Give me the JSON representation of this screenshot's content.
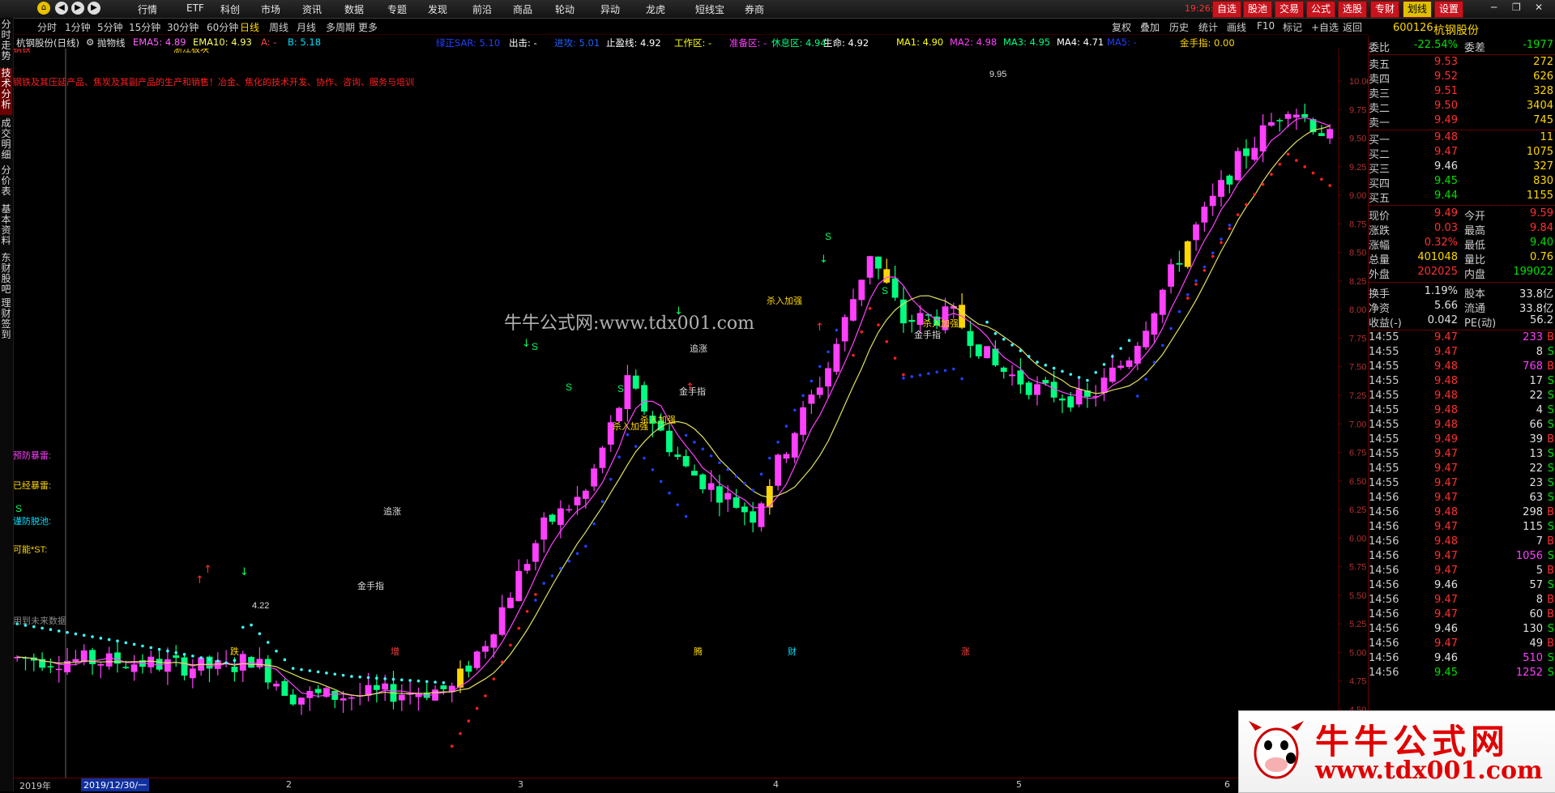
{
  "topbar": {
    "menus": [
      "行情",
      "ETF",
      "科创",
      "市场",
      "资讯",
      "数据",
      "专题",
      "发现",
      "前沿",
      "商品",
      "轮动",
      "异动",
      "龙虎",
      "短线宝",
      "券商"
    ],
    "clock": "19:26:03",
    "weekday": "周一",
    "right_buttons": [
      "自选",
      "股池",
      "交易",
      "公式",
      "选股",
      "专财",
      "划线",
      "设置"
    ]
  },
  "periodbar": {
    "periods": [
      "分时",
      "1分钟",
      "5分钟",
      "15分钟",
      "30分钟",
      "60分钟",
      "日线",
      "周线",
      "月线",
      "多周期",
      "更多"
    ],
    "active": "日线",
    "tools": [
      "复权",
      "叠加",
      "历史",
      "统计",
      "画线",
      "F10",
      "标记",
      "+自选",
      "返回"
    ]
  },
  "lefttabs": [
    "分时走势",
    "技术分析",
    "成交明细",
    "分价表",
    "基本资料",
    "东财股吧",
    "理财签到"
  ],
  "lefttabs_active": "技术分析",
  "indicator_line": {
    "name": "杭钢股份(日线)",
    "type": "抛物线",
    "ema5": "EMA5: 4.89",
    "ema10": "EMA10: 4.93",
    "a": "A: -",
    "b": "B: 5.18",
    "sar": "绿正SAR: 5.10",
    "out": "出击: -",
    "buy": "进攻: 5.01",
    "stop": "止盈线: 4.92",
    "work": "工作区: -",
    "ready": "准备区: -",
    "rest": "休息区: 4.94",
    "life": "生命: 4.92",
    "ma1": "MA1: 4.90",
    "ma2": "MA2: 4.98",
    "ma3": "MA3: 4.95",
    "ma4": "MA4: 4.71",
    "ma5": "MA5: -",
    "golden": "金手指: 0.00"
  },
  "chart_text": {
    "sector": "钢铁",
    "board": "浙江板块",
    "desc": "钢铁及其压延产品、焦炭及其副产品的生产和销售！冶金、焦化的技术开发、协作、咨询、服务与培训",
    "warn1": "预防暴雷:",
    "warn2": "已经暴雷:",
    "warn3": "谨防脱池:",
    "warn4": "可能*ST:",
    "future": "用到未来数据",
    "high_label": "9.95",
    "low_label": "4.22",
    "chase1": "追涨",
    "chase2": "追涨",
    "buy_strong1": "杀入加强",
    "buy_strong2": "杀入加强",
    "buy_strong3": "杀入加强",
    "buy_strong4": "杀入加强",
    "golden1": "金手指",
    "golden2": "金手指",
    "golden3": "金手指",
    "mark_drop": "跌",
    "mark_inc": "增",
    "mark_rise": "腾",
    "mark_fortune": "财",
    "mark_up": "涨",
    "watermark_top": "牛牛公式网:www.tdx001.com"
  },
  "price_axis": [
    "10.00",
    "9.75",
    "9.50",
    "9.25",
    "9.00",
    "8.75",
    "8.50",
    "8.25",
    "8.00",
    "7.75",
    "7.50",
    "7.25",
    "7.00",
    "6.75",
    "6.50",
    "6.25",
    "6.00",
    "5.75",
    "5.50",
    "5.25",
    "5.00",
    "4.75",
    "4.50"
  ],
  "bottom_axis": {
    "year": "2019年",
    "date": "2019/12/30/一",
    "months": [
      "2",
      "3",
      "4",
      "5",
      "6"
    ]
  },
  "quote": {
    "code": "600126",
    "name": "杭钢股份",
    "webi_label": "委比",
    "webi": "-22.54%",
    "weicha_label": "委差",
    "weicha": "-1977",
    "asks": [
      {
        "label": "卖五",
        "price": "9.53",
        "vol": "272"
      },
      {
        "label": "卖四",
        "price": "9.52",
        "vol": "626"
      },
      {
        "label": "卖三",
        "price": "9.51",
        "vol": "328"
      },
      {
        "label": "卖二",
        "price": "9.50",
        "vol": "3404"
      },
      {
        "label": "卖一",
        "price": "9.49",
        "vol": "745"
      }
    ],
    "bids": [
      {
        "label": "买一",
        "price": "9.48",
        "vol": "11"
      },
      {
        "label": "买二",
        "price": "9.47",
        "vol": "1075"
      },
      {
        "label": "买三",
        "price": "9.46",
        "vol": "327"
      },
      {
        "label": "买四",
        "price": "9.45",
        "vol": "830"
      },
      {
        "label": "买五",
        "price": "9.44",
        "vol": "1155"
      }
    ],
    "stats": [
      {
        "l1": "现价",
        "v1": "9.49",
        "c1": "red",
        "l2": "今开",
        "v2": "9.59",
        "c2": "red"
      },
      {
        "l1": "涨跌",
        "v1": "0.03",
        "c1": "red",
        "l2": "最高",
        "v2": "9.84",
        "c2": "red"
      },
      {
        "l1": "涨幅",
        "v1": "0.32%",
        "c1": "red",
        "l2": "最低",
        "v2": "9.40",
        "c2": "green"
      },
      {
        "l1": "总量",
        "v1": "401048",
        "c1": "yellow",
        "l2": "量比",
        "v2": "0.76",
        "c2": "yellow"
      },
      {
        "l1": "外盘",
        "v1": "202025",
        "c1": "red",
        "l2": "内盘",
        "v2": "199022",
        "c2": "green"
      }
    ],
    "stats2": [
      {
        "l1": "换手",
        "v1": "1.19%",
        "l2": "股本",
        "v2": "33.8亿"
      },
      {
        "l1": "净资",
        "v1": "5.66",
        "l2": "流通",
        "v2": "33.8亿"
      },
      {
        "l1": "收益(-)",
        "v1": "0.042",
        "l2": "PE(动)",
        "v2": "56.2"
      }
    ],
    "ticks": [
      {
        "t": "14:55",
        "p": "9.47",
        "pc": "red",
        "v": "233",
        "vc": "mag",
        "s": "B"
      },
      {
        "t": "14:55",
        "p": "9.47",
        "pc": "red",
        "v": "8",
        "vc": "white",
        "s": "S"
      },
      {
        "t": "14:55",
        "p": "9.48",
        "pc": "red",
        "v": "768",
        "vc": "mag",
        "s": "B"
      },
      {
        "t": "14:55",
        "p": "9.48",
        "pc": "red",
        "v": "17",
        "vc": "white",
        "s": "S"
      },
      {
        "t": "14:55",
        "p": "9.48",
        "pc": "red",
        "v": "22",
        "vc": "white",
        "s": "S"
      },
      {
        "t": "14:55",
        "p": "9.48",
        "pc": "red",
        "v": "4",
        "vc": "white",
        "s": "S"
      },
      {
        "t": "14:55",
        "p": "9.48",
        "pc": "red",
        "v": "66",
        "vc": "white",
        "s": "S"
      },
      {
        "t": "14:55",
        "p": "9.49",
        "pc": "red",
        "v": "39",
        "vc": "white",
        "s": "B"
      },
      {
        "t": "14:55",
        "p": "9.47",
        "pc": "red",
        "v": "13",
        "vc": "white",
        "s": "S"
      },
      {
        "t": "14:55",
        "p": "9.47",
        "pc": "red",
        "v": "22",
        "vc": "white",
        "s": "S"
      },
      {
        "t": "14:55",
        "p": "9.47",
        "pc": "red",
        "v": "23",
        "vc": "white",
        "s": "S"
      },
      {
        "t": "14:56",
        "p": "9.47",
        "pc": "red",
        "v": "63",
        "vc": "white",
        "s": "S"
      },
      {
        "t": "14:56",
        "p": "9.48",
        "pc": "red",
        "v": "298",
        "vc": "white",
        "s": "B"
      },
      {
        "t": "14:56",
        "p": "9.47",
        "pc": "red",
        "v": "115",
        "vc": "white",
        "s": "S"
      },
      {
        "t": "14:56",
        "p": "9.48",
        "pc": "red",
        "v": "7",
        "vc": "white",
        "s": "B"
      },
      {
        "t": "14:56",
        "p": "9.47",
        "pc": "red",
        "v": "1056",
        "vc": "mag",
        "s": "S"
      },
      {
        "t": "14:56",
        "p": "9.47",
        "pc": "red",
        "v": "5",
        "vc": "white",
        "s": "B"
      },
      {
        "t": "14:56",
        "p": "9.46",
        "pc": "white",
        "v": "57",
        "vc": "white",
        "s": "S"
      },
      {
        "t": "14:56",
        "p": "9.47",
        "pc": "red",
        "v": "8",
        "vc": "white",
        "s": "B"
      },
      {
        "t": "14:56",
        "p": "9.47",
        "pc": "red",
        "v": "60",
        "vc": "white",
        "s": "B"
      },
      {
        "t": "14:56",
        "p": "9.46",
        "pc": "white",
        "v": "130",
        "vc": "white",
        "s": "S"
      },
      {
        "t": "14:56",
        "p": "9.47",
        "pc": "red",
        "v": "49",
        "vc": "white",
        "s": "B"
      },
      {
        "t": "14:56",
        "p": "9.46",
        "pc": "white",
        "v": "510",
        "vc": "mag",
        "s": "S"
      },
      {
        "t": "14:56",
        "p": "9.45",
        "pc": "green",
        "v": "1252",
        "vc": "mag",
        "s": "S"
      }
    ]
  },
  "watermark": {
    "title": "牛牛公式网",
    "url": "www.tdx001.com"
  },
  "colors": {
    "up": "#ff40ff",
    "down": "#00ff80",
    "yellow_candle": "#ffd700",
    "ma_yellow": "#e0e060",
    "ma_pink": "#ff40ff",
    "sar_red": "#ff2020",
    "sar_blue": "#2040ff",
    "sar_cyan": "#40ffff",
    "grid_border": "#600000"
  }
}
